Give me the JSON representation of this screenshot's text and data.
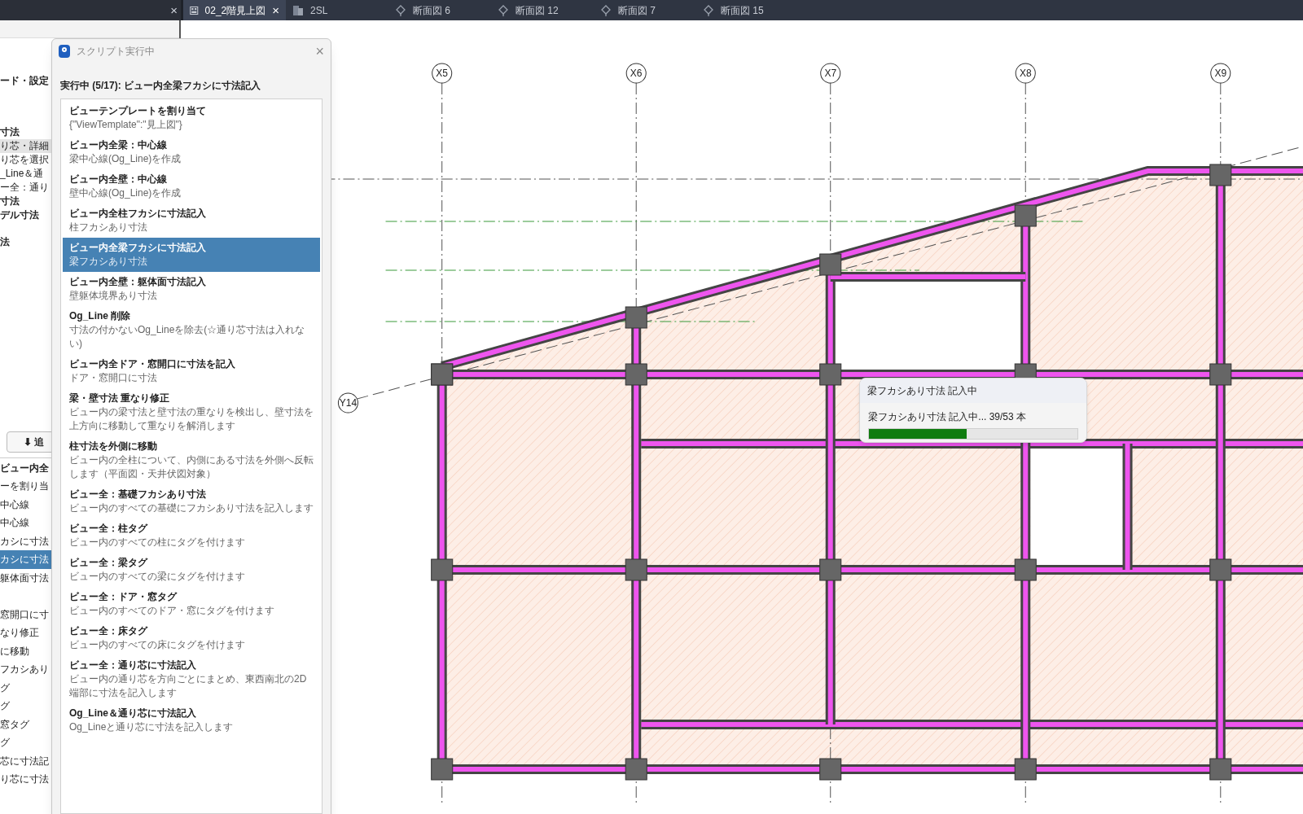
{
  "panel_close": "×",
  "tabs": [
    {
      "label": "02_2階見上図",
      "selected": true,
      "kind": "plan",
      "close": "×"
    },
    {
      "label": "2SL",
      "selected": false,
      "kind": "sheet"
    },
    {
      "label": "断面図 6",
      "selected": false,
      "kind": "section"
    },
    {
      "label": "断面図 12",
      "selected": false,
      "kind": "section"
    },
    {
      "label": "断面図 7",
      "selected": false,
      "kind": "section"
    },
    {
      "label": "断面図 15",
      "selected": false,
      "kind": "section"
    }
  ],
  "side_panel": {
    "upper_items": [
      {
        "text": "ード・設定",
        "kind": "heading",
        "selected": false
      },
      {
        "text": "寸法",
        "kind": "heading",
        "selected": false
      },
      {
        "text": "り芯・詳細",
        "kind": "item",
        "selected": true
      },
      {
        "text": "り芯を選択",
        "kind": "item",
        "selected": false
      },
      {
        "text": "_Line＆通",
        "kind": "item",
        "selected": false
      },
      {
        "text": "ー全：通り",
        "kind": "item",
        "selected": false
      },
      {
        "text": "寸法",
        "kind": "heading",
        "selected": false
      },
      {
        "text": "デル寸法",
        "kind": "heading",
        "selected": false
      },
      {
        "text": "法",
        "kind": "heading",
        "selected": false
      }
    ],
    "button": "⬇ 追",
    "list_header": "ビュー内全",
    "list_items": [
      {
        "text": "ーを割り当",
        "selected": false
      },
      {
        "text": "中心線",
        "selected": false
      },
      {
        "text": "中心線",
        "selected": false
      },
      {
        "text": "カシに寸法",
        "selected": false
      },
      {
        "text": "カシに寸法",
        "selected": true
      },
      {
        "text": "躯体面寸法",
        "selected": false
      },
      {
        "text": "窓開口に寸",
        "selected": false,
        "gap": true
      },
      {
        "text": "なり修正",
        "selected": false
      },
      {
        "text": "に移動",
        "selected": false
      },
      {
        "text": "フカシあり",
        "selected": false
      },
      {
        "text": "グ",
        "selected": false
      },
      {
        "text": "グ",
        "selected": false
      },
      {
        "text": "窓タグ",
        "selected": false
      },
      {
        "text": "グ",
        "selected": false
      },
      {
        "text": "芯に寸法記",
        "selected": false
      },
      {
        "text": "り芯に寸法",
        "selected": false
      }
    ]
  },
  "dialog": {
    "title": "スクリプト実行中",
    "close": "×",
    "status": "実行中 (5/17): ビュー内全梁フカシに寸法記入",
    "steps": [
      {
        "title": "ビューテンプレートを割り当て",
        "desc": "{\"ViewTemplate\":\"見上図\"}",
        "selected": false
      },
      {
        "title": "ビュー内全梁：中心線",
        "desc": "梁中心線(Og_Line)を作成",
        "selected": false
      },
      {
        "title": "ビュー内全壁：中心線",
        "desc": "壁中心線(Og_Line)を作成",
        "selected": false
      },
      {
        "title": "ビュー内全柱フカシに寸法記入",
        "desc": "柱フカシあり寸法",
        "selected": false
      },
      {
        "title": "ビュー内全梁フカシに寸法記入",
        "desc": "梁フカシあり寸法",
        "selected": true
      },
      {
        "title": "ビュー内全壁：躯体面寸法記入",
        "desc": "壁躯体境界あり寸法",
        "selected": false
      },
      {
        "title": "Og_Line 削除",
        "desc": "寸法の付かないOg_Lineを除去(☆通り芯寸法は入れない)",
        "selected": false
      },
      {
        "title": "ビュー内全ドア・窓開口に寸法を記入",
        "desc": "ドア・窓開口に寸法",
        "selected": false
      },
      {
        "title": "梁・壁寸法 重なり修正",
        "desc": "ビュー内の梁寸法と壁寸法の重なりを検出し、壁寸法を上方向に移動して重なりを解消します",
        "selected": false
      },
      {
        "title": "柱寸法を外側に移動",
        "desc": "ビュー内の全柱について、内側にある寸法を外側へ反転します（平面図・天井伏図対象）",
        "selected": false
      },
      {
        "title": "ビュー全：基礎フカシあり寸法",
        "desc": "ビュー内のすべての基礎にフカシあり寸法を記入します",
        "selected": false
      },
      {
        "title": "ビュー全：柱タグ",
        "desc": "ビュー内のすべての柱にタグを付けます",
        "selected": false
      },
      {
        "title": "ビュー全：梁タグ",
        "desc": "ビュー内のすべての梁にタグを付けます",
        "selected": false
      },
      {
        "title": "ビュー全：ドア・窓タグ",
        "desc": "ビュー内のすべてのドア・窓にタグを付けます",
        "selected": false
      },
      {
        "title": "ビュー全：床タグ",
        "desc": "ビュー内のすべての床にタグを付けます",
        "selected": false
      },
      {
        "title": "ビュー全：通り芯に寸法記入",
        "desc": "ビュー内の通り芯を方向ごとにまとめ、東西南北の2D端部に寸法を記入します",
        "selected": false
      },
      {
        "title": "Og_Line＆通り芯に寸法記入",
        "desc": "Og_Lineと通り芯に寸法を記入します",
        "selected": false
      }
    ]
  },
  "progress": {
    "title": "梁フカシあり寸法 記入中",
    "message": "梁フカシあり寸法 記入中... 39/53 本",
    "level": 0.47
  },
  "grid_labels": [
    "X5",
    "X6",
    "X7",
    "X8",
    "X9",
    "Y14"
  ]
}
